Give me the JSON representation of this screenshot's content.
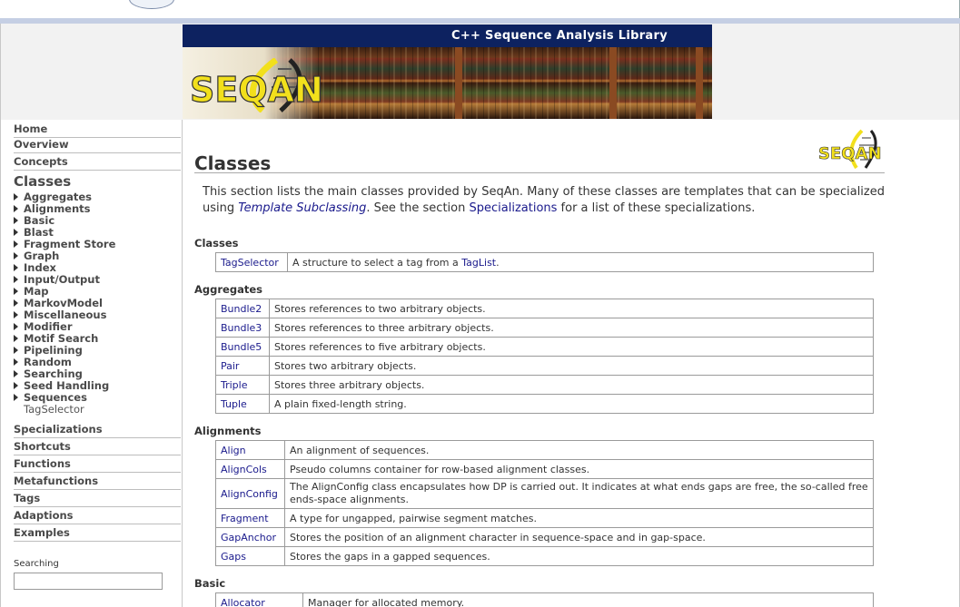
{
  "banner": {
    "subtitle": "C++ Sequence Analysis Library",
    "logo_text": "SEQAN"
  },
  "sidebar": {
    "top_items": [
      {
        "label": "Home"
      },
      {
        "label": "Overview"
      },
      {
        "label": "Concepts"
      }
    ],
    "current_section": "Classes",
    "sub_items": [
      {
        "label": "Aggregates"
      },
      {
        "label": "Alignments"
      },
      {
        "label": "Basic"
      },
      {
        "label": "Blast"
      },
      {
        "label": "Fragment Store"
      },
      {
        "label": "Graph"
      },
      {
        "label": "Index"
      },
      {
        "label": "Input/Output"
      },
      {
        "label": "Map"
      },
      {
        "label": "MarkovModel"
      },
      {
        "label": "Miscellaneous"
      },
      {
        "label": "Modifier"
      },
      {
        "label": "Motif Search"
      },
      {
        "label": "Pipelining"
      },
      {
        "label": "Random"
      },
      {
        "label": "Searching"
      },
      {
        "label": "Seed Handling"
      },
      {
        "label": "Sequences"
      }
    ],
    "plain_item": "TagSelector",
    "bottom_items": [
      {
        "label": "Specializations"
      },
      {
        "label": "Shortcuts"
      },
      {
        "label": "Functions"
      },
      {
        "label": "Metafunctions"
      },
      {
        "label": "Tags"
      },
      {
        "label": "Adaptions"
      },
      {
        "label": "Examples"
      }
    ],
    "search": {
      "label": "Searching",
      "value": ""
    }
  },
  "main": {
    "title": "Classes",
    "logo_text": "SEQAN",
    "intro": {
      "part1": "This section lists the main classes provided by SeqAn. Many of these classes are templates that can be specialized using ",
      "link1": "Template Subclassing",
      "part2": ". See the section ",
      "link2": "Specializations",
      "part3": " for a list of these specializations."
    },
    "sections": [
      {
        "heading": "Classes",
        "rows": [
          {
            "name": "TagSelector",
            "desc_pre": "A structure to select a tag from a ",
            "desc_link": "TagList",
            "desc_post": "."
          }
        ]
      },
      {
        "heading": "Aggregates",
        "rows": [
          {
            "name": "Bundle2",
            "desc": "Stores references to two arbitrary objects."
          },
          {
            "name": "Bundle3",
            "desc": "Stores references to three arbitrary objects."
          },
          {
            "name": "Bundle5",
            "desc": "Stores references to five arbitrary objects."
          },
          {
            "name": "Pair",
            "desc": "Stores two arbitrary objects."
          },
          {
            "name": "Triple",
            "desc": "Stores three arbitrary objects."
          },
          {
            "name": "Tuple",
            "desc": "A plain fixed-length string."
          }
        ]
      },
      {
        "heading": "Alignments",
        "rows": [
          {
            "name": "Align",
            "desc": "An alignment of sequences."
          },
          {
            "name": "AlignCols",
            "desc": "Pseudo columns container for row-based alignment classes."
          },
          {
            "name": "AlignConfig",
            "desc": "The AlignConfig class encapsulates how DP is carried out. It indicates at what ends gaps are free, the so-called free ends-space alignments."
          },
          {
            "name": "Fragment",
            "desc": "A type for ungapped, pairwise segment matches."
          },
          {
            "name": "GapAnchor",
            "desc": "Stores the position of an alignment character in sequence-space and in gap-space."
          },
          {
            "name": "Gaps",
            "desc": "Stores the gaps in a gapped sequences."
          }
        ]
      },
      {
        "heading": "Basic",
        "rows": [
          {
            "name": "Allocator",
            "desc": "Manager for allocated memory."
          }
        ]
      }
    ]
  },
  "colors": {
    "banner_bar": "#0d2260",
    "link": "#1a1a8c",
    "logo_yellow": "#f2e01c"
  }
}
